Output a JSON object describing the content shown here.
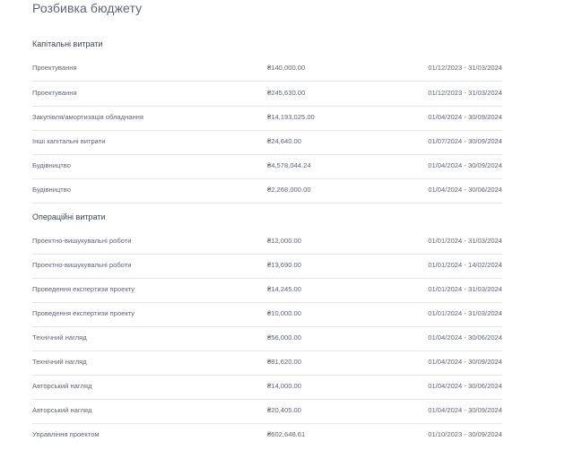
{
  "page": {
    "title": "Розбивка бюджету"
  },
  "sections": [
    {
      "title": "Капітальні витрати",
      "rows": [
        {
          "name": "Проектування",
          "amount": "₴140,000.00",
          "period": "01/12/2023 - 31/03/2024"
        },
        {
          "name": "Проектування",
          "amount": "₴245,630.00",
          "period": "01/12/2023 - 31/03/2024"
        },
        {
          "name": "Закупівля/амортизація обладнання",
          "amount": "₴14,193,025.00",
          "period": "01/04/2024 - 30/09/2024"
        },
        {
          "name": "Інші капітальні витрати",
          "amount": "₴24,640.00",
          "period": "01/07/2024 - 30/09/2024"
        },
        {
          "name": "Будівництво",
          "amount": "₴4,578,044.24",
          "period": "01/04/2024 - 30/09/2024"
        },
        {
          "name": "Будівництво",
          "amount": "₴2,268,000.00",
          "period": "01/04/2024 - 30/06/2024"
        }
      ]
    },
    {
      "title": "Операційні витрати",
      "rows": [
        {
          "name": "Проектно-вишукувальні роботи",
          "amount": "₴12,000.00",
          "period": "01/01/2024 - 31/03/2024"
        },
        {
          "name": "Проектно-вишукувальні роботи",
          "amount": "₴13,690.00",
          "period": "01/01/2024 - 14/02/2024"
        },
        {
          "name": "Проведення експертизи проекту",
          "amount": "₴14,245.00",
          "period": "01/01/2024 - 31/03/2024"
        },
        {
          "name": "Проведення експертизи проекту",
          "amount": "₴10,000.00",
          "period": "01/01/2024 - 31/03/2024"
        },
        {
          "name": "Технічний нагляд",
          "amount": "₴56,000.00",
          "period": "01/04/2024 - 30/06/2024"
        },
        {
          "name": "Технічний нагляд",
          "amount": "₴81,620.00",
          "period": "01/04/2024 - 30/09/2024"
        },
        {
          "name": "Авторський нагляд",
          "amount": "₴14,000.00",
          "period": "01/04/2024 - 30/06/2024"
        },
        {
          "name": "Авторський нагляд",
          "amount": "₴20,405.00",
          "period": "01/04/2024 - 30/09/2024"
        },
        {
          "name": "Управління проектом",
          "amount": "₴602,648.61",
          "period": "01/10/2023 - 30/09/2024"
        }
      ]
    }
  ]
}
